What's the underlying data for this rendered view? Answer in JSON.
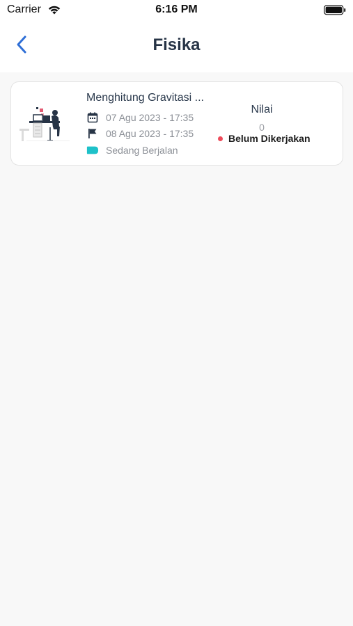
{
  "status_bar": {
    "carrier": "Carrier",
    "time": "6:16 PM"
  },
  "header": {
    "title": "Fisika",
    "back_icon": "chevron-left-icon"
  },
  "colors": {
    "accent": "#2f6fd6",
    "title_text": "#273446",
    "status_badge": "#1ec1c9",
    "not_done_dot": "#ee4b5a",
    "background": "#f8f8f8"
  },
  "assignment": {
    "title": "Menghitung Gravitasi ...",
    "start": "07 Agu 2023 - 17:35",
    "end": "08 Agu 2023 - 17:35",
    "status": "Sedang Berjalan",
    "score_label": "Nilai",
    "score_value": "0",
    "work_status": "Belum Dikerjakan",
    "icons": {
      "start": "calendar-icon",
      "end": "flag-icon",
      "status": "tag-icon",
      "thumbnail": "desk-illustration"
    }
  }
}
